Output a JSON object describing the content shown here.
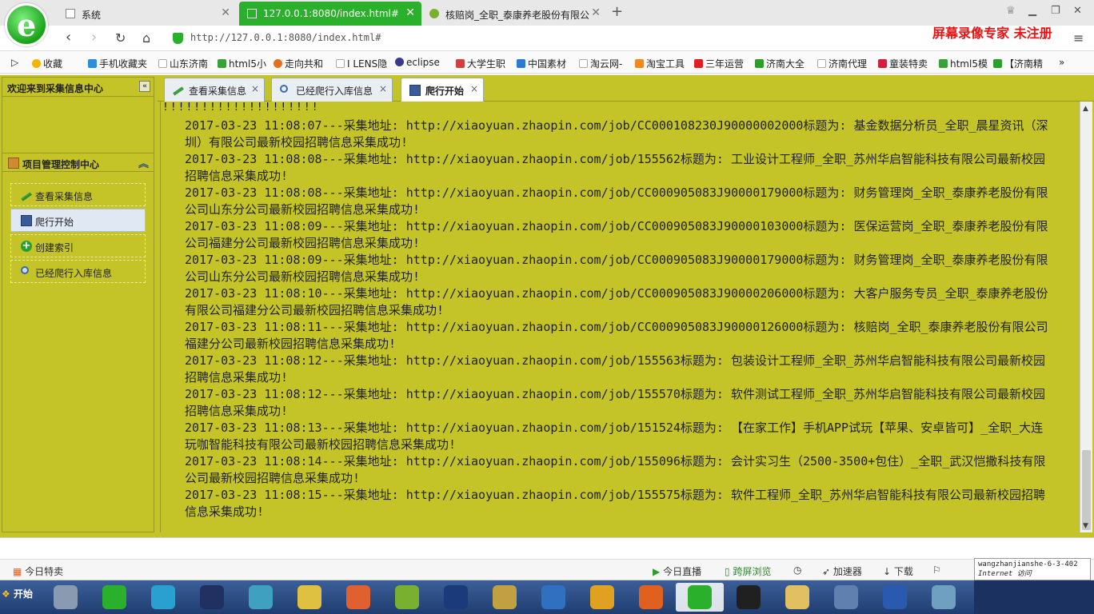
{
  "browser": {
    "tabs": [
      {
        "label": "系统",
        "close": "✕"
      },
      {
        "label": "127.0.0.1:8080/index.html#",
        "close": "✕"
      },
      {
        "label": "核赔岗_全职_泰康养老股份有限公",
        "close": "✕"
      }
    ],
    "new_tab": "+",
    "url": "http://127.0.0.1:8080/index.html#",
    "watermark": "屏幕录像专家 未注册"
  },
  "bookmarks": [
    {
      "label": "收藏",
      "color": "#f5b300"
    },
    {
      "label": "手机收藏夹",
      "color": "#2a8fd6"
    },
    {
      "label": "山东济南",
      "color": "#bbbbbb"
    },
    {
      "label": "html5小",
      "color": "#3aa03a"
    },
    {
      "label": "走向共和",
      "color": "#e07020"
    },
    {
      "label": "I LENS隐",
      "color": "#bbbbbb"
    },
    {
      "label": "eclipse",
      "color": "#3a3a8a"
    },
    {
      "label": "大学生职",
      "color": "#d04040"
    },
    {
      "label": "中国素材",
      "color": "#2a7ad6"
    },
    {
      "label": "淘云网-",
      "color": "#bbbbbb"
    },
    {
      "label": "淘宝工具",
      "color": "#f08a20"
    },
    {
      "label": "三年运营",
      "color": "#e02020"
    },
    {
      "label": "济南大全",
      "color": "#2aa02a"
    },
    {
      "label": "济南代理",
      "color": "#bbbbbb"
    },
    {
      "label": "童装特卖",
      "color": "#d02040"
    },
    {
      "label": "html5模",
      "color": "#3aa03a"
    },
    {
      "label": "【济南精",
      "color": "#2aa02a"
    }
  ],
  "sidebar": {
    "title": "欢迎来到采集信息中心",
    "collapse": "«",
    "panel_title": "项目管理控制中心",
    "items": [
      {
        "label": "查看采集信息",
        "icon": "pencil-icon"
      },
      {
        "label": "爬行开始",
        "icon": "save-icon"
      },
      {
        "label": "创建索引",
        "icon": "plus-icon"
      },
      {
        "label": "已经爬行入库信息",
        "icon": "magnifier-icon"
      }
    ]
  },
  "content_tabs": [
    {
      "label": "查看采集信息",
      "close": "×"
    },
    {
      "label": "已经爬行入库信息",
      "close": "×"
    },
    {
      "label": "爬行开始",
      "close": "×"
    }
  ],
  "log": {
    "top_partial": "!!!!!!!!!!!!!!!!!!!!",
    "lines": [
      "2017-03-23 11:08:07---采集地址: http://xiaoyuan.zhaopin.com/job/CC000108230J90000002000标题为: 基金数据分析员_全职_晨星资讯（深圳）有限公司最新校园招聘信息采集成功!",
      "2017-03-23 11:08:08---采集地址: http://xiaoyuan.zhaopin.com/job/155562标题为: 工业设计工程师_全职_苏州华启智能科技有限公司最新校园招聘信息采集成功!",
      "2017-03-23 11:08:08---采集地址: http://xiaoyuan.zhaopin.com/job/CC000905083J90000179000标题为: 财务管理岗_全职_泰康养老股份有限公司山东分公司最新校园招聘信息采集成功!",
      "2017-03-23 11:08:09---采集地址: http://xiaoyuan.zhaopin.com/job/CC000905083J90000103000标题为: 医保运营岗_全职_泰康养老股份有限公司福建分公司最新校园招聘信息采集成功!",
      "2017-03-23 11:08:09---采集地址: http://xiaoyuan.zhaopin.com/job/CC000905083J90000179000标题为: 财务管理岗_全职_泰康养老股份有限公司山东分公司最新校园招聘信息采集成功!",
      "2017-03-23 11:08:10---采集地址: http://xiaoyuan.zhaopin.com/job/CC000905083J90000206000标题为: 大客户服务专员_全职_泰康养老股份有限公司福建分公司最新校园招聘信息采集成功!",
      "2017-03-23 11:08:11---采集地址: http://xiaoyuan.zhaopin.com/job/CC000905083J90000126000标题为: 核赔岗_全职_泰康养老股份有限公司福建分公司最新校园招聘信息采集成功!",
      "2017-03-23 11:08:12---采集地址: http://xiaoyuan.zhaopin.com/job/155563标题为: 包装设计工程师_全职_苏州华启智能科技有限公司最新校园招聘信息采集成功!",
      "2017-03-23 11:08:12---采集地址: http://xiaoyuan.zhaopin.com/job/155570标题为: 软件测试工程师_全职_苏州华启智能科技有限公司最新校园招聘信息采集成功!",
      "2017-03-23 11:08:13---采集地址: http://xiaoyuan.zhaopin.com/job/151524标题为: 【在家工作】手机APP试玩【苹果、安卓皆可】_全职_大连玩咖智能科技有限公司最新校园招聘信息采集成功!",
      "2017-03-23 11:08:14---采集地址: http://xiaoyuan.zhaopin.com/job/155096标题为: 会计实习生（2500-3500+包住）_全职_武汉恺撒科技有限公司最新校园招聘信息采集成功!",
      "2017-03-23 11:08:15---采集地址: http://xiaoyuan.zhaopin.com/job/155575标题为: 软件工程师_全职_苏州华启智能科技有限公司最新校园招聘信息采集成功!"
    ]
  },
  "statusbar": {
    "left": "今日特卖",
    "live": "今日直播",
    "cross_screen": "跨屏浏览",
    "accelerator": "加速器",
    "download": "下载"
  },
  "ie_tag": {
    "line1": "wangzhanjianshe-6-3-402",
    "line2": "Internet 访问"
  },
  "taskbar": {
    "start": "开始",
    "apps": [
      {
        "icon": "terminal-app-icon",
        "color": "#8a9ab0"
      },
      {
        "icon": "ie-app-icon",
        "color": "#2ab02a"
      },
      {
        "icon": "globe-app-icon",
        "color": "#2aa0d0"
      },
      {
        "icon": "s-app-icon",
        "color": "#203060"
      },
      {
        "icon": "transfer-app-icon",
        "color": "#40a0c0"
      },
      {
        "icon": "face-app-icon",
        "color": "#e0c040"
      },
      {
        "icon": "db-app-icon",
        "color": "#e06030"
      },
      {
        "icon": "android-app-icon",
        "color": "#7ab030"
      },
      {
        "icon": "photoshop-app-icon",
        "color": "#1a3a7a"
      },
      {
        "icon": "tools-app-icon",
        "color": "#c0a040"
      },
      {
        "icon": "network-app-icon",
        "color": "#3070c0"
      },
      {
        "icon": "search-app-icon",
        "color": "#e0a020"
      },
      {
        "icon": "paw-app-icon",
        "color": "#e06020"
      },
      {
        "icon": "browser-app-icon",
        "color": "#2ab02a"
      },
      {
        "icon": "qq-app-icon",
        "color": "#202020"
      },
      {
        "icon": "folder-app-icon",
        "color": "#e0c060"
      },
      {
        "icon": "computer-app-icon",
        "color": "#6080b0"
      },
      {
        "icon": "word-app-icon",
        "color": "#2a5ab0"
      },
      {
        "icon": "notebook-app-icon",
        "color": "#70a0c0"
      }
    ]
  }
}
